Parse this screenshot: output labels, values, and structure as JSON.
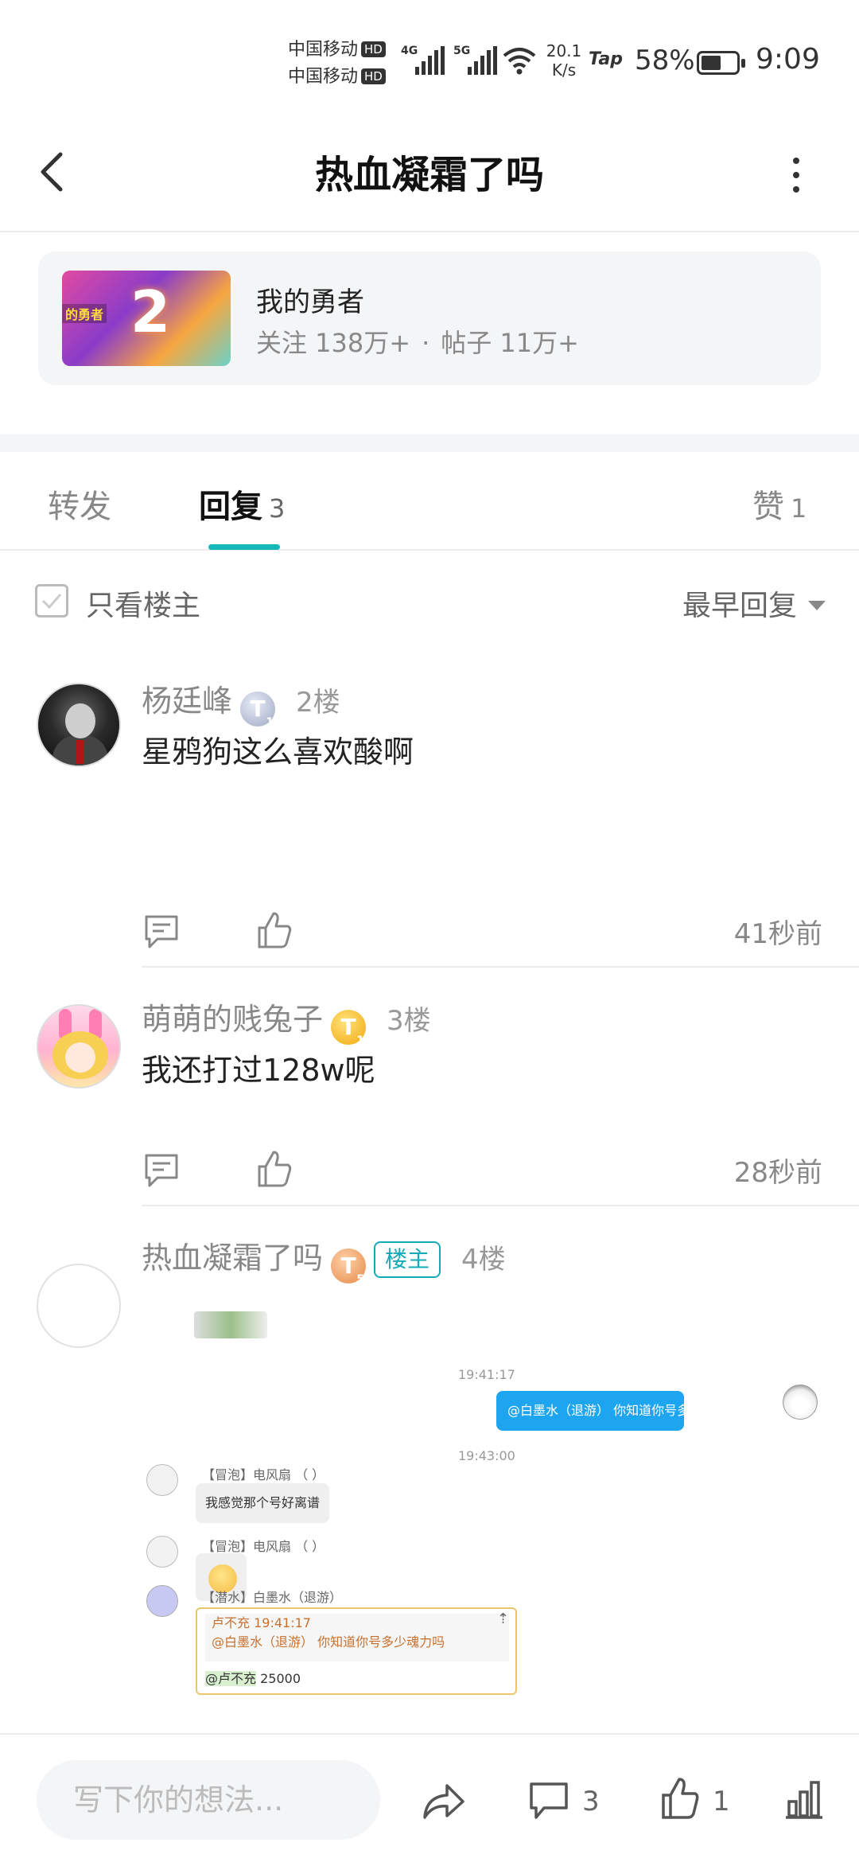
{
  "status_bar": {
    "carrier1": "中国移动",
    "carrier2": "中国移动",
    "hd": "HD",
    "net1": "4G",
    "net2": "5G",
    "speed_value": "20.1",
    "speed_unit": "K/s",
    "tap": "Tap",
    "battery": "58%",
    "battery_level": 0.58,
    "time": "9:09"
  },
  "header": {
    "title": "热血凝霜了吗"
  },
  "group": {
    "name": "我的勇者",
    "followers_label": "关注 138万+",
    "separator": "·",
    "posts_label": "帖子 11万+",
    "thumb_number": "2",
    "thumb_tag": "的勇者"
  },
  "tabs": [
    {
      "label": "转发",
      "count": ""
    },
    {
      "label": "回复",
      "count": "3"
    },
    {
      "label": "赞",
      "count": "1"
    }
  ],
  "filter": {
    "only_owner": "只看楼主",
    "sort": "最早回复"
  },
  "posts": [
    {
      "username": "杨廷峰",
      "badge": "T",
      "badge_level": "1",
      "floor": "2楼",
      "content": "星鸦狗这么喜欢酸啊",
      "time": "41秒前"
    },
    {
      "username": "萌萌的贱兔子",
      "badge": "T",
      "badge_level": "1",
      "floor": "3楼",
      "content": "我还打过128w呢",
      "time": "28秒前"
    },
    {
      "username": "热血凝霜了吗",
      "badge": "T",
      "badge_level": "5",
      "owner_tag": "楼主",
      "floor": "4楼"
    }
  ],
  "chat_screenshot": {
    "time1": "19:41:17",
    "msg_right": "@白墨水（退游） 你知道你号多少魂力吗",
    "time2": "19:43:00",
    "nick1": "【冒泡】电风扇 （ ）",
    "msg1": "我感觉那个号好离谱",
    "nick2": "【冒泡】电风扇 （ ）",
    "nick3": "【潜水】白墨水（退游）",
    "quote_header": "卢不充   19:41:17",
    "quote_text": "@白墨水（退游） 你知道你号多少魂力吗",
    "quote_pin": "⇡",
    "reply_mention": "@卢不充",
    "reply_text": " 25000"
  },
  "bottom_bar": {
    "placeholder": "写下你的想法...",
    "comment_count": "3",
    "like_count": "1"
  },
  "colors": {
    "accent": "#15b8b8",
    "owner_tag": "#15aab8",
    "chat_bubble": "#1ea5f0"
  }
}
